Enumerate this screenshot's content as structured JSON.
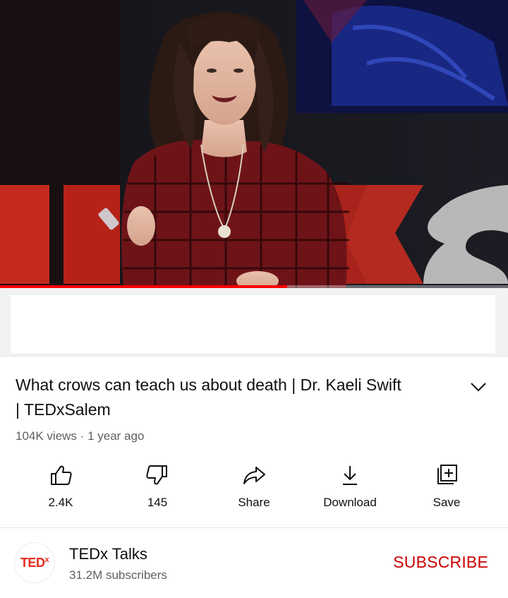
{
  "video": {
    "progress_fraction": 0.565,
    "progress_color": "#ff0000"
  },
  "title": {
    "line1": "What crows can teach us about death | Dr. Kaeli Swift",
    "line2": "| TEDxSalem"
  },
  "meta": {
    "views": "104K views",
    "separator": "·",
    "age": "1 year ago"
  },
  "actions": [
    {
      "label": "2.4K",
      "icon": "thumbs-up-icon"
    },
    {
      "label": "145",
      "icon": "thumbs-down-icon"
    },
    {
      "label": "Share",
      "icon": "share-icon"
    },
    {
      "label": "Download",
      "icon": "download-icon"
    },
    {
      "label": "Save",
      "icon": "save-to-playlist-icon"
    }
  ],
  "channel": {
    "avatar_text": "TED",
    "avatar_sup": "x",
    "name": "TEDx Talks",
    "subscribers": "31.2M subscribers",
    "subscribe_label": "SUBSCRIBE",
    "subscribe_color": "#cc0000"
  }
}
